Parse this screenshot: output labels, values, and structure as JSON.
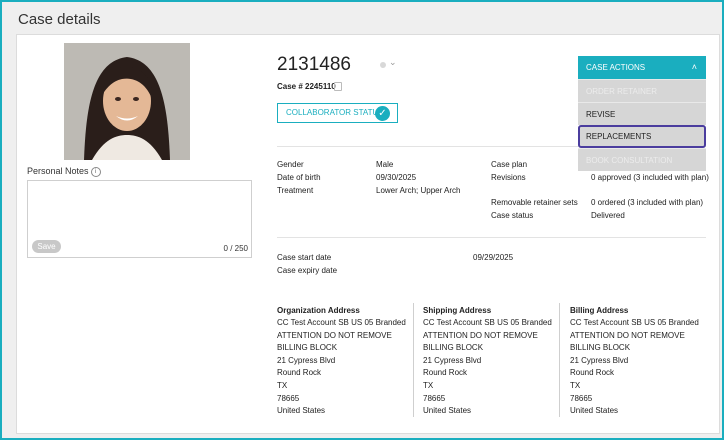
{
  "page": {
    "title": "Case details"
  },
  "patient": {
    "id": "2131486",
    "case_number": "Case # 2245110"
  },
  "collaborator": {
    "label": "COLLABORATOR STATUS"
  },
  "notes": {
    "label": "Personal Notes",
    "save_label": "Save",
    "counter": "0 / 250",
    "value": ""
  },
  "case_actions": {
    "header": "CASE ACTIONS",
    "items": [
      {
        "label": "ORDER RETAINER",
        "enabled": false
      },
      {
        "label": "REVISE",
        "enabled": true
      },
      {
        "label": "REPLACEMENTS",
        "enabled": true,
        "focused": true
      },
      {
        "label": "BOOK CONSULTATION",
        "enabled": false
      }
    ]
  },
  "details": {
    "gender": {
      "label": "Gender",
      "value": "Male"
    },
    "dob": {
      "label": "Date of birth",
      "value": "09/30/2025"
    },
    "treatment": {
      "label": "Treatment",
      "value": "Lower Arch; Upper Arch"
    },
    "case_plan": {
      "label": "Case plan",
      "value": ""
    },
    "revisions": {
      "label": "Revisions",
      "value": "0 approved (3 included with plan)"
    },
    "removable": {
      "label": "Removable retainer sets",
      "value": "0 ordered (3 included with plan)"
    },
    "case_status": {
      "label": "Case status",
      "value": "Delivered"
    }
  },
  "dates": {
    "start": {
      "label": "Case start date",
      "value": "09/29/2025"
    },
    "expiry": {
      "label": "Case expiry date",
      "value": ""
    }
  },
  "addresses": [
    {
      "title": "Organization Address",
      "lines": [
        "CC Test Account SB US 05 Branded",
        "ATTENTION DO NOT REMOVE",
        "BILLING BLOCK",
        "21 Cypress Blvd",
        "Round Rock",
        "TX",
        "78665",
        "United States"
      ]
    },
    {
      "title": "Shipping Address",
      "lines": [
        "CC Test Account SB US 05 Branded",
        "ATTENTION DO NOT REMOVE",
        "BILLING BLOCK",
        "21 Cypress Blvd",
        "Round Rock",
        "TX",
        "78665",
        "United States"
      ]
    },
    {
      "title": "Billing Address",
      "lines": [
        "CC Test Account SB US 05 Branded",
        "ATTENTION DO NOT REMOVE",
        "BILLING BLOCK",
        "21 Cypress Blvd",
        "Round Rock",
        "TX",
        "78665",
        "United States"
      ]
    }
  ],
  "icons": {
    "info": "info-icon",
    "copy": "copy-icon",
    "check": "check-circle-icon",
    "status_chevron": "chevron-down-icon",
    "menu_chevron": "chevron-up-icon"
  },
  "colors": {
    "accent": "#1aaebf",
    "focus": "#4b3d9e",
    "menu_bg": "#d6d6d6"
  }
}
